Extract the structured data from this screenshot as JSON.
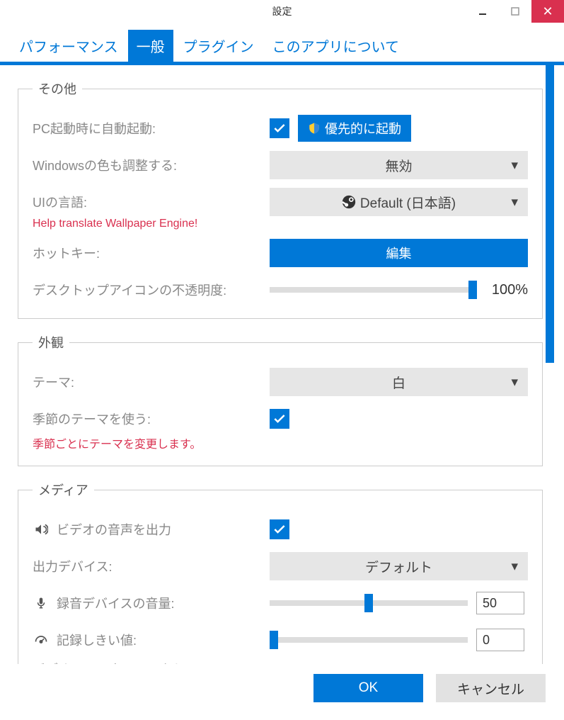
{
  "window": {
    "title": "設定"
  },
  "tabs": [
    "パフォーマンス",
    "一般",
    "プラグイン",
    "このアプリについて"
  ],
  "active_tab": 1,
  "sections": {
    "other": {
      "legend": "その他",
      "auto_start": {
        "label": "PC起動時に自動起動:",
        "checked": true,
        "priority_btn": "優先的に起動"
      },
      "windows_color": {
        "label": "Windowsの色も調整する:",
        "value": "無効"
      },
      "ui_language": {
        "label": "UIの言語:",
        "value": "Default (日本語)",
        "help": "Help translate Wallpaper Engine!"
      },
      "hotkey": {
        "label": "ホットキー:",
        "button": "編集"
      },
      "icon_opacity": {
        "label": "デスクトップアイコンの不透明度:",
        "value": "100%",
        "percent": 100
      }
    },
    "appearance": {
      "legend": "外観",
      "theme": {
        "label": "テーマ:",
        "value": "白"
      },
      "seasonal": {
        "label": "季節のテーマを使う:",
        "checked": true,
        "help": "季節ごとにテーマを変更します。"
      }
    },
    "media": {
      "legend": "メディア",
      "video_audio": {
        "label": "ビデオの音声を出力",
        "checked": true
      },
      "output_device": {
        "label": "出力デバイス:",
        "value": "デフォルト"
      },
      "rec_volume": {
        "label": "録音デバイスの音量:",
        "value": "50",
        "percent": 50
      },
      "threshold": {
        "label": "記録しきい値:",
        "value": "0",
        "percent": 0
      },
      "hw_accel": {
        "label": "ビデオハードウェアアクセラレーシ"
      }
    }
  },
  "footer": {
    "ok": "OK",
    "cancel": "キャンセル"
  }
}
